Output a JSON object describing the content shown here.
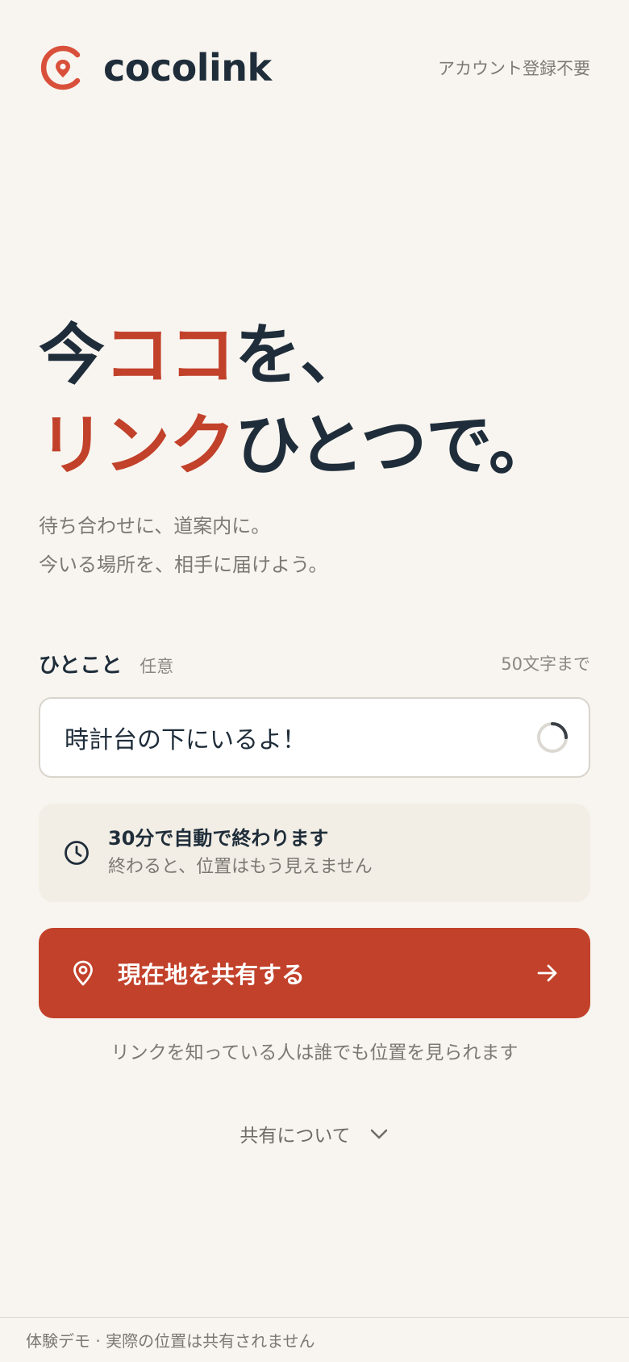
{
  "app": {
    "brand_name": "cocolink",
    "header_note": "アカウント登録不要",
    "brand_color": "#c2412a"
  },
  "hero": {
    "line1_part1": "今",
    "line1_accent": "ココ",
    "line1_part2": "を、",
    "line2_accent": "リンク",
    "line2_part2": "ひとつで。",
    "sub_line1": "待ち合わせに、道案内に。",
    "sub_line2": "今いる場所を、相手に届けよう。"
  },
  "field": {
    "label": "ひとこと",
    "optional": "任意",
    "limit": "50文字まで",
    "value": "時計台の下にいるよ！",
    "status_icon": "spinner-icon"
  },
  "info": {
    "icon": "clock-icon",
    "title": "30分で自動で終わります",
    "description": "終わると、位置はもう見えません"
  },
  "share_button": {
    "label": "現在地を共有する",
    "icon": "location-pin-icon",
    "trailing_icon": "arrow-right-icon"
  },
  "notice": "リンクを知っている人は誰でも位置を見られます",
  "about": {
    "label": "共有について",
    "icon": "chevron-down-icon"
  },
  "footer": "体験デモ · 実際の位置は共有されません"
}
